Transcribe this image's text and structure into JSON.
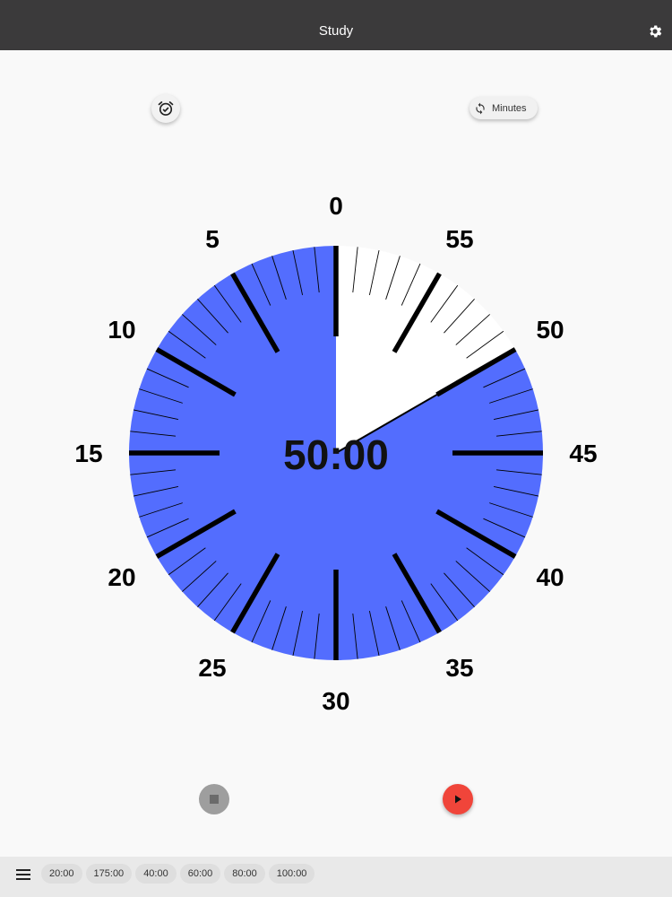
{
  "header": {
    "title": "Study",
    "settings_icon": "gear-icon"
  },
  "controls": {
    "alarm_icon": "alarm-check-icon",
    "mode_icon": "sync-icon",
    "mode_label": "Minutes"
  },
  "timer": {
    "display": "50:00",
    "remaining_minutes": 50,
    "total_minutes": 60,
    "fill_color": "#536dfe",
    "dial_labels": [
      "0",
      "5",
      "10",
      "15",
      "20",
      "25",
      "30",
      "35",
      "40",
      "45",
      "50",
      "55"
    ]
  },
  "playback": {
    "stop_icon": "stop-icon",
    "play_icon": "play-icon",
    "play_color": "#f0453a"
  },
  "bottom_bar": {
    "menu_icon": "menu-icon",
    "presets": [
      "20:00",
      "175:00",
      "40:00",
      "60:00",
      "80:00",
      "100:00"
    ]
  }
}
